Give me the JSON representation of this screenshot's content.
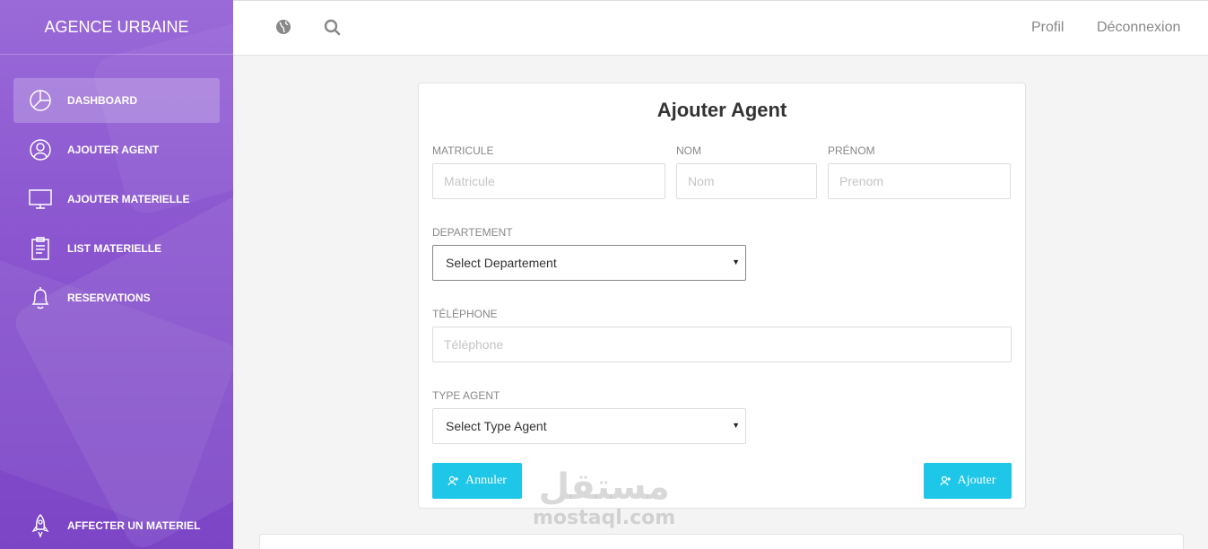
{
  "sidebar": {
    "brand": "AGENCE URBAINE",
    "items": [
      {
        "label": "DASHBOARD",
        "icon": "pie-chart-icon",
        "active": true
      },
      {
        "label": "AJOUTER AGENT",
        "icon": "user-icon",
        "active": false
      },
      {
        "label": "AJOUTER MATERIELLE",
        "icon": "monitor-icon",
        "active": false
      },
      {
        "label": "LIST MATERIELLE",
        "icon": "clipboard-icon",
        "active": false
      },
      {
        "label": "RESERVATIONS",
        "icon": "bell-icon",
        "active": false
      }
    ],
    "bottom_item": {
      "label": "AFFECTER UN MATERIEL",
      "icon": "rocket-icon"
    }
  },
  "topbar": {
    "globe_icon": "globe-icon",
    "search_icon": "search-icon",
    "profil": "Profil",
    "logout": "Déconnexion"
  },
  "form": {
    "title": "Ajouter Agent",
    "matricule_label": "MATRICULE",
    "matricule_placeholder": "Matricule",
    "nom_label": "NOM",
    "nom_placeholder": "Nom",
    "prenom_label": "PRÉNOM",
    "prenom_placeholder": "Prenom",
    "departement_label": "DEPARTEMENT",
    "departement_selected": "Select Departement",
    "telephone_label": "TÉLÉPHONE",
    "telephone_placeholder": "Téléphone",
    "type_label": "TYPE AGENT",
    "type_selected": "Select Type Agent",
    "cancel_label": "Annuler",
    "submit_label": "Ajouter"
  },
  "watermark": {
    "arabic": "مستقل",
    "latin": "mostaql.com"
  },
  "colors": {
    "sidebar": "#8a55cf",
    "accent": "#1ec6e8",
    "background": "#f4f4f4"
  }
}
